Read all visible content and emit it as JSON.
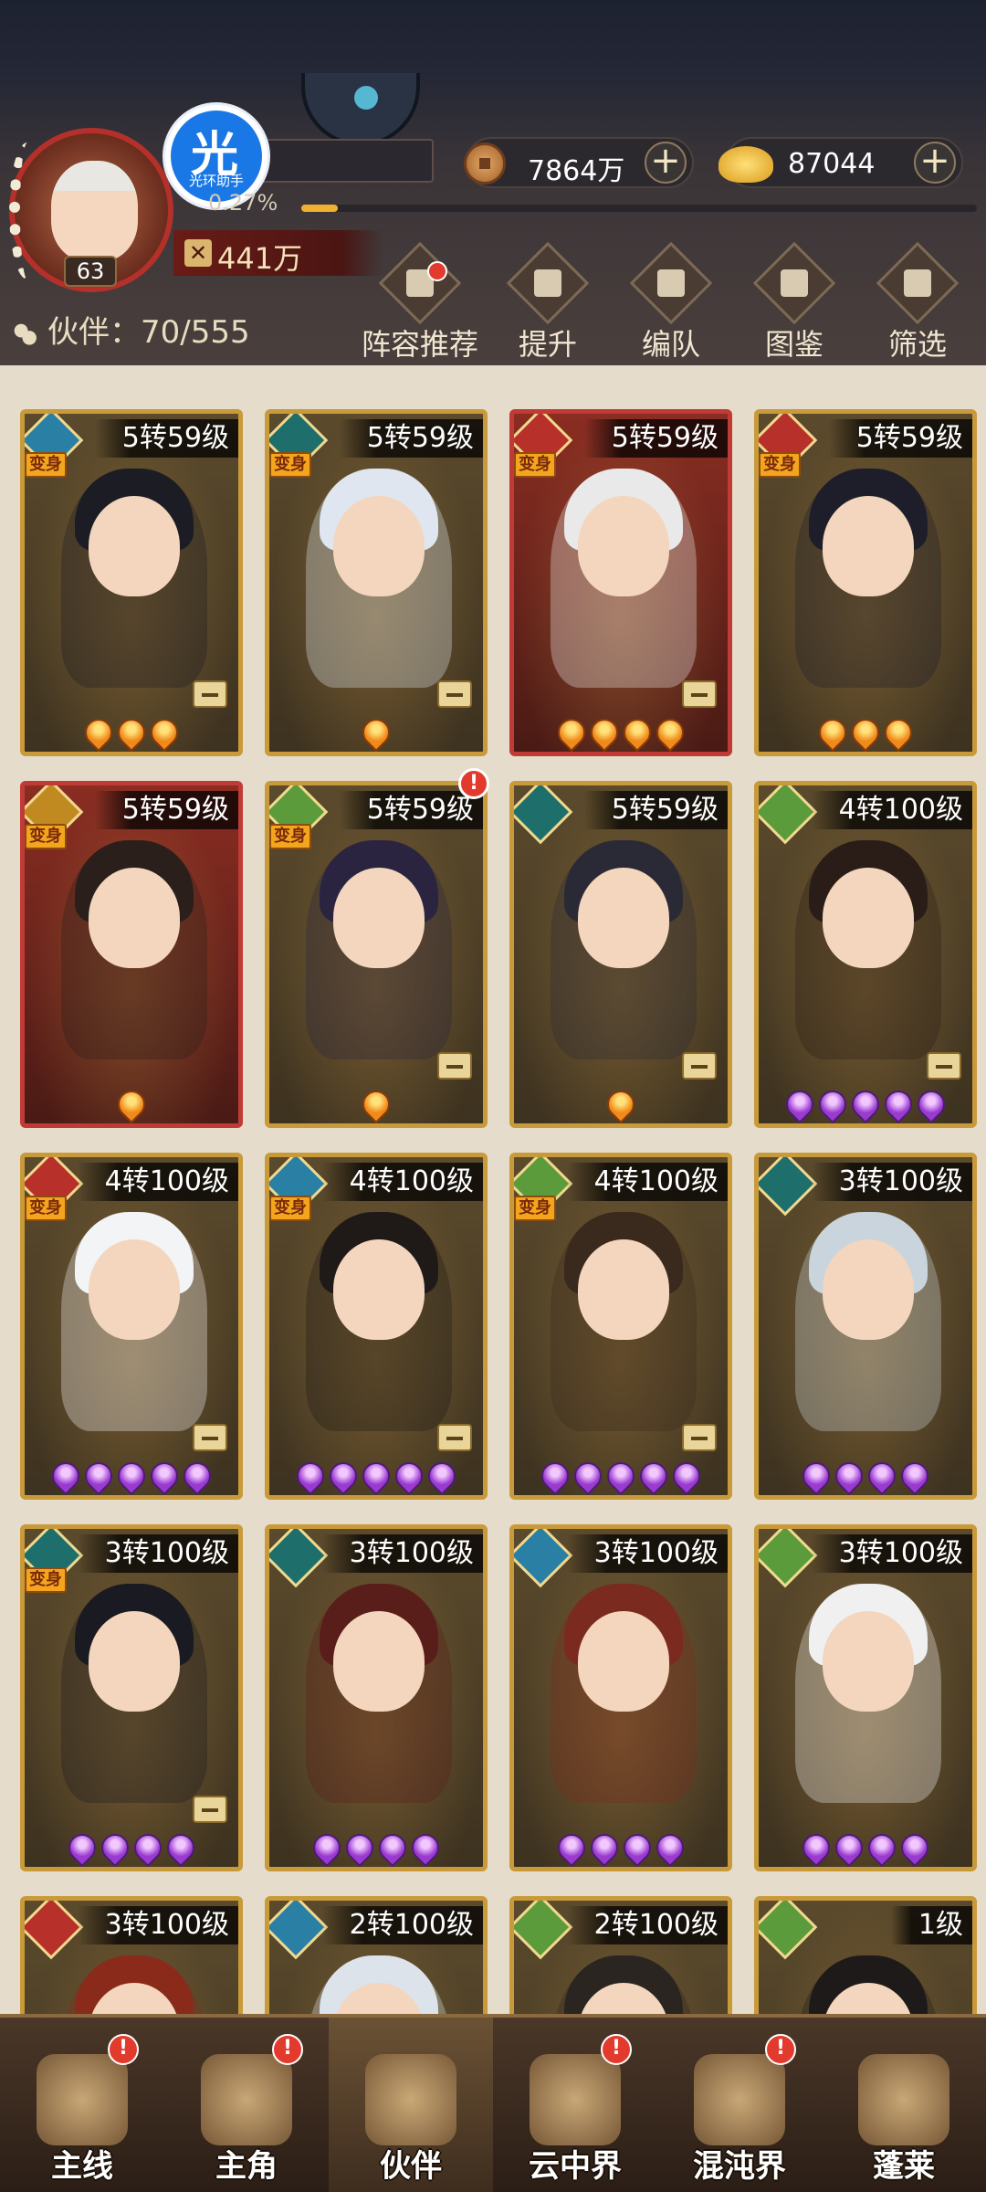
{
  "player": {
    "level": "63",
    "exp_percent_text": "0.27%",
    "exp_fraction": 0.0027,
    "power": "441万",
    "name_visible": "",
    "helper_badge": {
      "char": "光",
      "label": "光环助手"
    }
  },
  "currency": {
    "copper": "7864万",
    "gold": "87044"
  },
  "partners": {
    "label": "伙伴：70/555"
  },
  "toolbar": [
    {
      "label": "阵容推荐",
      "icon": "lineup-icon"
    },
    {
      "label": "提升",
      "icon": "upgrade-icon"
    },
    {
      "label": "编队",
      "icon": "formation-icon"
    },
    {
      "label": "图鉴",
      "icon": "atlas-icon"
    },
    {
      "label": "筛选",
      "icon": "filter-icon"
    }
  ],
  "cards": [
    {
      "level": "5转59级",
      "element": "water",
      "transform": "变身",
      "stars": 3,
      "star_color": "orange",
      "frame": "gold",
      "hair": "#1c1c24",
      "minus": true
    },
    {
      "level": "5转59级",
      "element": "teal",
      "transform": "变身",
      "stars": 1,
      "star_color": "orange",
      "frame": "gold",
      "hair": "#dfe6f0",
      "minus": true
    },
    {
      "level": "5转59级",
      "element": "fire",
      "transform": "变身",
      "stars": 4,
      "star_color": "orange",
      "frame": "red",
      "hair": "#e9e9e9",
      "minus": true
    },
    {
      "level": "5转59级",
      "element": "fire",
      "transform": "变身",
      "stars": 3,
      "star_color": "orange",
      "frame": "gold",
      "hair": "#1e1e2a",
      "minus": false
    },
    {
      "level": "5转59级",
      "element": "gold",
      "transform": "变身",
      "stars": 1,
      "star_color": "orange",
      "frame": "red",
      "hair": "#2a1f1a",
      "minus": false
    },
    {
      "level": "5转59级",
      "element": "wood",
      "transform": "变身",
      "stars": 1,
      "star_color": "orange",
      "frame": "gold",
      "hair": "#2b2440",
      "minus": true,
      "alert": "!"
    },
    {
      "level": "5转59级",
      "element": "teal",
      "transform": "",
      "stars": 1,
      "star_color": "orange",
      "frame": "gold",
      "hair": "#2a2a36",
      "minus": true
    },
    {
      "level": "4转100级",
      "element": "wood",
      "transform": "",
      "stars": 5,
      "star_color": "purple",
      "frame": "gold",
      "hair": "#2a1d18",
      "minus": true
    },
    {
      "level": "4转100级",
      "element": "fire",
      "transform": "变身",
      "stars": 5,
      "star_color": "purple",
      "frame": "gold",
      "hair": "#f2f4f6",
      "minus": true
    },
    {
      "level": "4转100级",
      "element": "water",
      "transform": "变身",
      "stars": 5,
      "star_color": "purple",
      "frame": "gold",
      "hair": "#1f1a18",
      "minus": true
    },
    {
      "level": "4转100级",
      "element": "wood",
      "transform": "变身",
      "stars": 5,
      "star_color": "purple",
      "frame": "gold",
      "hair": "#3a2a1e",
      "minus": true
    },
    {
      "level": "3转100级",
      "element": "teal",
      "transform": "",
      "stars": 4,
      "star_color": "purple",
      "frame": "gold",
      "hair": "#c9d4dc",
      "minus": false
    },
    {
      "level": "3转100级",
      "element": "teal",
      "transform": "变身",
      "stars": 4,
      "star_color": "purple",
      "frame": "gold",
      "hair": "#1a1a22",
      "minus": true
    },
    {
      "level": "3转100级",
      "element": "teal",
      "transform": "",
      "stars": 4,
      "star_color": "purple",
      "frame": "gold",
      "hair": "#5a1e1a",
      "minus": false
    },
    {
      "level": "3转100级",
      "element": "water",
      "transform": "",
      "stars": 4,
      "star_color": "purple",
      "frame": "gold",
      "hair": "#7a2a1e",
      "minus": false
    },
    {
      "level": "3转100级",
      "element": "wood",
      "transform": "",
      "stars": 4,
      "star_color": "purple",
      "frame": "gold",
      "hair": "#f0f0f0",
      "minus": false
    },
    {
      "level": "3转100级",
      "element": "fire",
      "transform": "",
      "stars": 0,
      "star_color": "purple",
      "frame": "gold",
      "hair": "#8a2a1a",
      "minus": false
    },
    {
      "level": "2转100级",
      "element": "water",
      "transform": "",
      "stars": 0,
      "star_color": "purple",
      "frame": "gold",
      "hair": "#dde3ea",
      "minus": false
    },
    {
      "level": "2转100级",
      "element": "wood",
      "transform": "",
      "stars": 0,
      "star_color": "purple",
      "frame": "gold",
      "hair": "#2a2520",
      "minus": false
    },
    {
      "level": "1级",
      "element": "wood",
      "transform": "",
      "stars": 0,
      "star_color": "purple",
      "frame": "gold",
      "hair": "#1e1a1a",
      "minus": false
    }
  ],
  "nav": [
    {
      "label": "主线",
      "alert": "!",
      "active": false
    },
    {
      "label": "主角",
      "alert": "!",
      "active": false
    },
    {
      "label": "伙伴",
      "alert": "",
      "active": true
    },
    {
      "label": "云中界",
      "alert": "!",
      "active": false
    },
    {
      "label": "混沌界",
      "alert": "!",
      "active": false
    },
    {
      "label": "蓬莱",
      "alert": "",
      "active": false
    }
  ],
  "colors": {
    "accent_gold": "#c99a3a",
    "alert_red": "#e23b2e",
    "exp_fill": "#f0b030"
  }
}
